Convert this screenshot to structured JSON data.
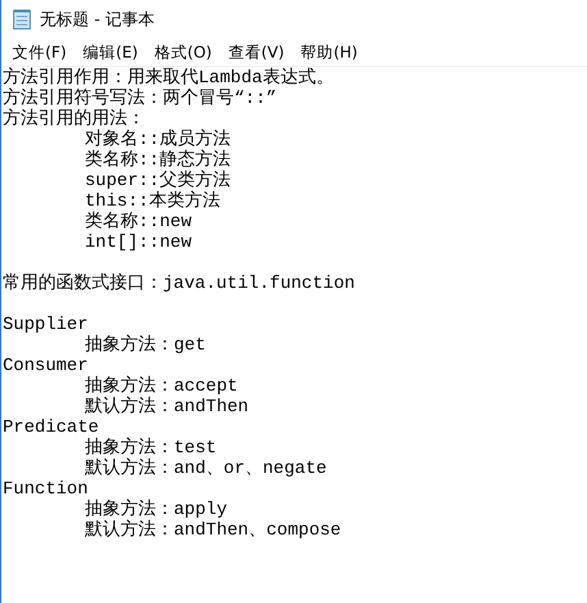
{
  "window": {
    "title": "无标题 - 记事本"
  },
  "menu": [
    "文件(F)",
    "编辑(E)",
    "格式(O)",
    "查看(V)",
    "帮助(H)"
  ],
  "blocks": [
    [
      "方法引用作用：用来取代Lambda表达式。",
      "方法引用符号写法：两个冒号“::”",
      "方法引用的用法：",
      "\t对象名::成员方法",
      "\t类名称::静态方法",
      "\tsuper::父类方法",
      "\tthis::本类方法",
      "\t类名称::new",
      "\tint[]::new"
    ],
    [
      "常用的函数式接口：java.util.function"
    ],
    [
      "Supplier",
      "\t抽象方法：get",
      "Consumer",
      "\t抽象方法：accept",
      "\t默认方法：andThen",
      "Predicate",
      "\t抽象方法：test",
      "\t默认方法：and、or、negate",
      "Function",
      "\t抽象方法：apply",
      "\t默认方法：andThen、compose"
    ]
  ]
}
